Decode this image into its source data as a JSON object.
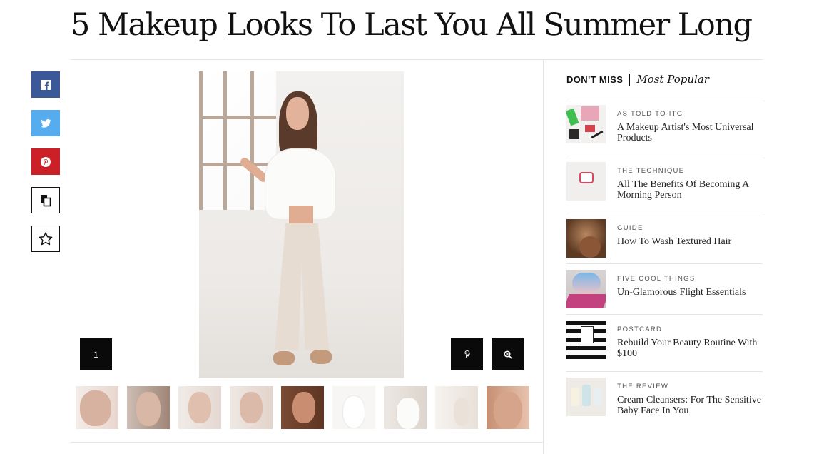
{
  "article": {
    "title": "5 Makeup Looks To Last You All Summer Long"
  },
  "gallery": {
    "current_slide": "1",
    "thumbnail_count": 9
  },
  "share": [
    {
      "name": "facebook-share-button",
      "icon": "facebook-icon",
      "color": "#3b5998"
    },
    {
      "name": "twitter-share-button",
      "icon": "twitter-icon",
      "color": "#55acee"
    },
    {
      "name": "pinterest-share-button",
      "icon": "pinterest-icon",
      "color": "#cb2027"
    },
    {
      "name": "copy-link-button",
      "icon": "copy-icon"
    },
    {
      "name": "favorite-button",
      "icon": "star-icon"
    }
  ],
  "sidebar": {
    "dont_miss": "DON'T MISS",
    "most_popular": "Most Popular",
    "stories": [
      {
        "kicker": "AS TOLD TO ITG",
        "title": "A Makeup Artist's Most Universal Products"
      },
      {
        "kicker": "THE TECHNIQUE",
        "title": "All The Benefits Of Becoming A Morning Person"
      },
      {
        "kicker": "GUIDE",
        "title": "How To Wash Textured Hair"
      },
      {
        "kicker": "FIVE COOL THINGS",
        "title": "Un-Glamorous Flight Essentials"
      },
      {
        "kicker": "POSTCARD",
        "title": "Rebuild Your Beauty Routine With $100"
      },
      {
        "kicker": "THE REVIEW",
        "title": "Cream Cleansers: For The Sensitive Baby Face In You"
      }
    ]
  }
}
